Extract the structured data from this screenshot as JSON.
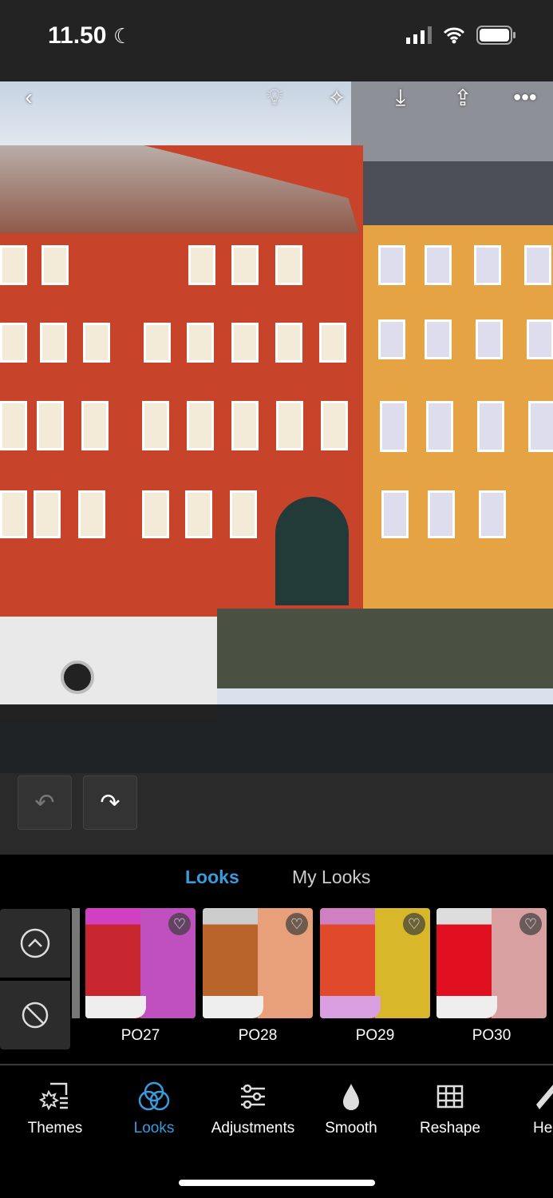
{
  "status_bar": {
    "time": "11.50"
  },
  "photo_toolbar": {
    "icons": [
      "back-icon",
      "lightbulb-icon",
      "magic-wand-icon",
      "download-icon",
      "share-icon",
      "more-icon"
    ]
  },
  "looks_tabs": {
    "tabs": [
      {
        "label": "Looks",
        "active": true
      },
      {
        "label": "My Looks",
        "active": false
      }
    ]
  },
  "looks": [
    {
      "label": "PO27",
      "colors": [
        "#c8262f",
        "#c050c0"
      ]
    },
    {
      "label": "PO28",
      "colors": [
        "#b8642a",
        "#e8a07a"
      ]
    },
    {
      "label": "PO29",
      "colors": [
        "#e04a2a",
        "#d8b828"
      ]
    },
    {
      "label": "PO30",
      "colors": [
        "#e01020",
        "#d8a0a0"
      ]
    }
  ],
  "bottom_nav": [
    {
      "label": "Themes",
      "active": false
    },
    {
      "label": "Looks",
      "active": true
    },
    {
      "label": "Adjustments",
      "active": false
    },
    {
      "label": "Smooth",
      "active": false
    },
    {
      "label": "Reshape",
      "active": false
    },
    {
      "label": "Heal",
      "active": false
    }
  ],
  "colors": {
    "accent": "#3a9bdc"
  }
}
